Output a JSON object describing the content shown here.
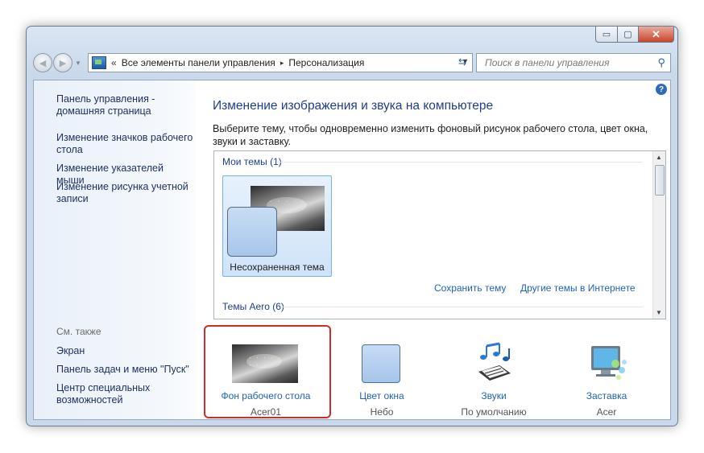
{
  "window": {
    "controls": {
      "minimize": "▭",
      "maximize": "▢",
      "close": "✕"
    }
  },
  "address": {
    "prefix": "«",
    "crumbs": [
      "Все элементы панели управления",
      "Персонализация"
    ],
    "sep": "▸",
    "dropdown": "▼"
  },
  "search": {
    "placeholder": "Поиск в панели управления"
  },
  "sidebar": {
    "links": [
      "Панель управления - домашняя страница",
      "Изменение значков рабочего стола",
      "Изменение указателей мыши",
      "Изменение рисунка учетной записи"
    ],
    "see_also_title": "См. также",
    "see_also": [
      "Экран",
      "Панель задач и меню \"Пуск\"",
      "Центр специальных возможностей"
    ]
  },
  "main": {
    "help": "?",
    "title": "Изменение изображения и звука на компьютере",
    "description": "Выберите тему, чтобы одновременно изменить фоновый рисунок рабочего стола, цвет окна, звуки и заставку.",
    "my_themes": "Мои темы (1)",
    "unsaved_theme": "Несохраненная тема",
    "save_theme": "Сохранить тему",
    "online_themes": "Другие темы в Интернете",
    "aero_themes": "Темы Aero (6)"
  },
  "bottom": [
    {
      "name": "Фон рабочего стола",
      "value": "Acer01"
    },
    {
      "name": "Цвет окна",
      "value": "Небо"
    },
    {
      "name": "Звуки",
      "value": "По умолчанию"
    },
    {
      "name": "Заставка",
      "value": "Acer"
    }
  ],
  "colors": {
    "highlight": "#d12c2c",
    "link": "#1f63b7",
    "title": "#1c3f8c"
  }
}
